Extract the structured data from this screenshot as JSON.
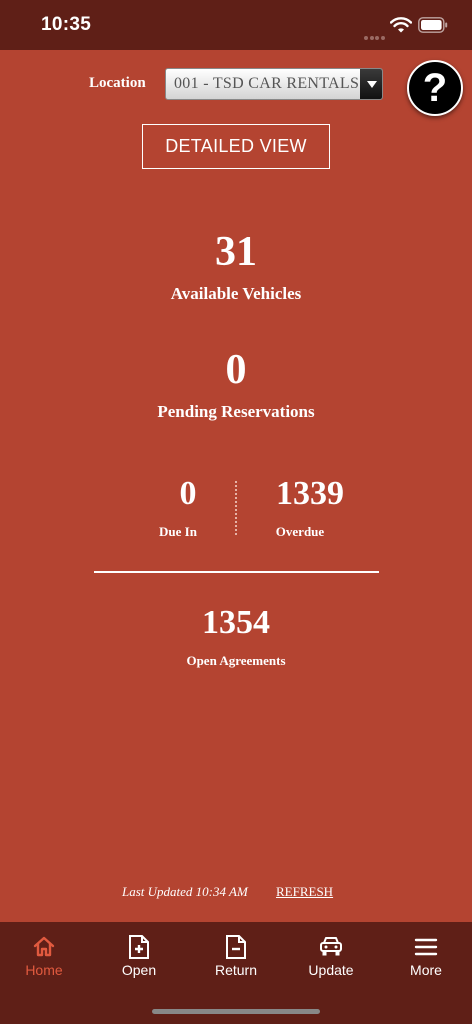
{
  "status": {
    "time": "10:35"
  },
  "header": {
    "location_label": "Location",
    "location_value": "001 - TSD CAR RENTALS",
    "help_label": "?",
    "detailed_view_label": "DETAILED VIEW"
  },
  "stats": {
    "available": {
      "value": "31",
      "label": "Available Vehicles"
    },
    "pending": {
      "value": "0",
      "label": "Pending Reservations"
    },
    "due_in": {
      "value": "0",
      "label": "Due In"
    },
    "overdue": {
      "value": "1339",
      "label": "Overdue"
    },
    "open_agreements": {
      "value": "1354",
      "label": "Open Agreements"
    }
  },
  "footer": {
    "last_updated": "Last Updated  10:34 AM",
    "refresh_label": "REFRESH"
  },
  "tabs": [
    {
      "label": "Home",
      "icon": "home-icon",
      "active": true
    },
    {
      "label": "Open",
      "icon": "document-plus-icon"
    },
    {
      "label": "Return",
      "icon": "document-minus-icon"
    },
    {
      "label": "Update",
      "icon": "car-icon"
    },
    {
      "label": "More",
      "icon": "menu-icon"
    }
  ],
  "colors": {
    "background": "#b44431",
    "bars": "#5f1f17",
    "active_tab": "#e15a3f"
  }
}
